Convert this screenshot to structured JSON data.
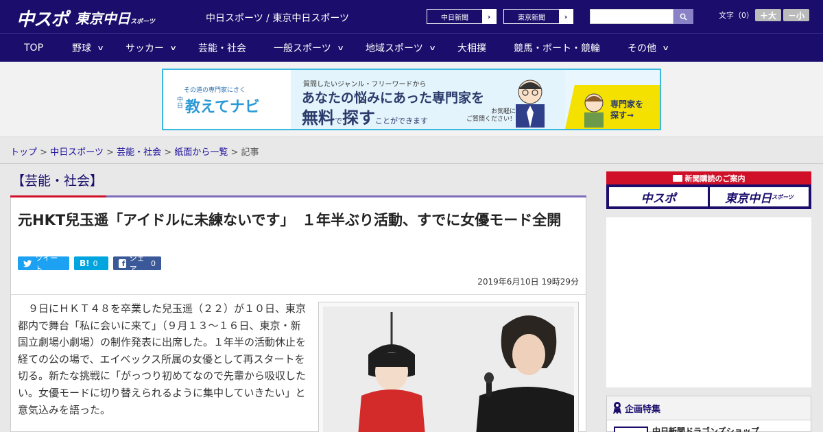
{
  "header": {
    "logo_chunichi": "中スポ",
    "logo_tokyo": "東京中日",
    "logo_tokyo_sub": "スポーツ",
    "site_title": "中日スポーツ / 東京中日スポーツ",
    "btn_chunichi": "中日新聞",
    "btn_tokyo": "東京新聞",
    "fontsize_label": "文字（0）",
    "fontsize_up": "＋大",
    "fontsize_down": "－小"
  },
  "nav": {
    "items": [
      {
        "label": "TOP"
      },
      {
        "label": "野球"
      },
      {
        "label": "サッカー"
      },
      {
        "label": "芸能・社会"
      },
      {
        "label": "一般スポーツ"
      },
      {
        "label": "地域スポーツ"
      },
      {
        "label": "大相撲"
      },
      {
        "label": "競馬・ボート・競輪"
      },
      {
        "label": "その他"
      }
    ]
  },
  "banner": {
    "tagline": "その道の専門家にきく",
    "brand": "教えてナビ",
    "brand_v": "中日",
    "line1": "質問したいジャンル・フリーワードから",
    "line2": "あなたの悩みにあった専門家を",
    "line3a": "無料",
    "line3b": "で",
    "line3c": "探す",
    "line3d": "ことができます",
    "line4a": "お気軽に",
    "line4b": "ご質問ください！",
    "cta1": "専門家を",
    "cta2": "探す→"
  },
  "breadcrumb": {
    "top": "トップ",
    "sep": ">",
    "chunichi": "中日スポーツ",
    "category": "芸能・社会",
    "list": "紙面から一覧",
    "current": "記事"
  },
  "article": {
    "category_heading": "【芸能・社会】",
    "headline": "元HKT兒玉遥「アイドルに未練ないです」　１年半ぶり活動、すでに女優モード全開",
    "tweet_label": "ツイート",
    "hatena_label": "B!",
    "hatena_count": "0",
    "share_label": "シェア",
    "share_count": "0",
    "date": "2019年6月10日 19時29分",
    "paragraph1": "９日にＨＫＴ４８を卒業した兒玉遥（２２）が１０日、東京都内で舞台「私に会いに来て」（９月１３～１６日、東京・新国立劇場小劇場）の制作発表に出席した。１年半の活動休止を経ての公の場で、エイベックス所属の女優として再スタートを切る。新たな挑戦に「がっつり初めてなので先輩から吸収したい。女優モードに切り替えられるように集中していきたい」と意気込みを語った。"
  },
  "sidebar": {
    "subscribe_title": "新聞購読のご案内",
    "logo1": "中スポ",
    "logo2": "東京中日",
    "logo2_sub": "スポーツ",
    "special_title": "企画特集",
    "special_item": "中日新聞ドラゴンズショップ"
  },
  "colors": {
    "brand_navy": "#1a0d6b",
    "accent_red": "#d01028",
    "twitter": "#1da1f2",
    "hatena": "#00a4de",
    "facebook": "#3b5998"
  }
}
